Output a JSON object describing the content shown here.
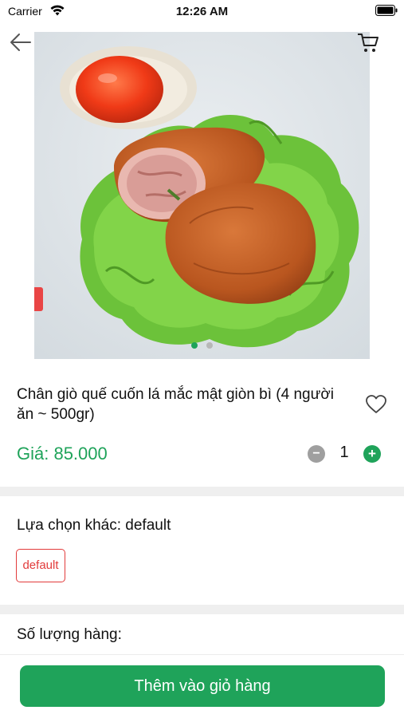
{
  "status_bar": {
    "carrier": "Carrier",
    "time": "12:26 AM"
  },
  "icons": {
    "back": "arrow-left-icon",
    "cart": "cart-icon",
    "favorite": "heart-outline-icon",
    "wifi": "wifi-icon",
    "battery": "battery-icon"
  },
  "gallery": {
    "active_index": 1,
    "total": 2
  },
  "product": {
    "name": "Chân giò quế cuốn lá mắc mật giòn bì (4 người ăn ~ 500gr)",
    "price": "Giá: 85.000"
  },
  "quantity": {
    "minus": "−",
    "value": "1",
    "plus": "+"
  },
  "options": {
    "label": "Lựa chọn khác: default",
    "chips": [
      "default"
    ]
  },
  "stock": {
    "label": "Số lượng hàng:"
  },
  "actions": {
    "add_to_cart": "Thêm vào giỏ hàng"
  },
  "colors": {
    "accent_green": "#1fa35a",
    "chip_red": "#e23b3b",
    "divider_gray": "#efefef"
  }
}
